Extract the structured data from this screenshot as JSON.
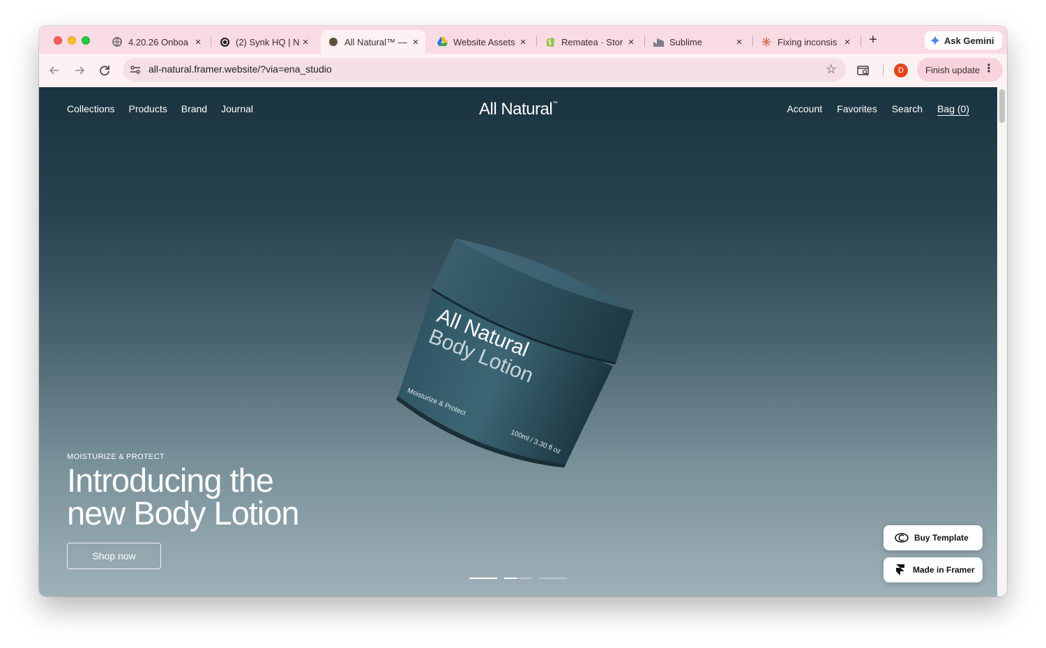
{
  "browser": {
    "tabs": [
      {
        "title": "4.20.26 Onboa",
        "icon": "globe-icon"
      },
      {
        "title": "(2) Synk HQ | N",
        "icon": "synk-icon"
      },
      {
        "title": "All Natural™ —",
        "icon": "site-icon",
        "active": true
      },
      {
        "title": "Website Assets",
        "icon": "google-drive-icon"
      },
      {
        "title": "Rematea · Stor",
        "icon": "shopify-icon"
      },
      {
        "title": "Sublime",
        "icon": "sublime-icon"
      },
      {
        "title": "Fixing inconsis",
        "icon": "claude-icon"
      }
    ],
    "new_tab_label": "+",
    "ask_gemini_label": "Ask Gemini",
    "url": "all-natural.framer.website/?via=ena_studio",
    "avatar_initial": "D",
    "finish_update_label": "Finish update",
    "colors": {
      "tabstrip": "#f9dbe3",
      "toolbar": "#fdf1f4",
      "avatar": "#e2451d"
    }
  },
  "site": {
    "nav_left": [
      "Collections",
      "Products",
      "Brand",
      "Journal"
    ],
    "logo": "All Natural",
    "logo_mark": "™",
    "nav_right": {
      "account": "Account",
      "favorites": "Favorites",
      "search": "Search",
      "bag": "Bag (0)"
    },
    "hero": {
      "eyebrow": "MOISTURIZE & PROTECT",
      "headline_line1": "Introducing the",
      "headline_line2": "new Body Lotion",
      "cta": "Shop now",
      "slide_indicators": 3,
      "active_slide": 2
    },
    "product": {
      "brand": "All Natural",
      "name": "Body Lotion",
      "tagline": "Moisturize & Protect",
      "volume": "100ml / 3.30 fl oz"
    },
    "badges": {
      "buy_template": "Buy Template",
      "made_in_framer": "Made in Framer"
    }
  }
}
